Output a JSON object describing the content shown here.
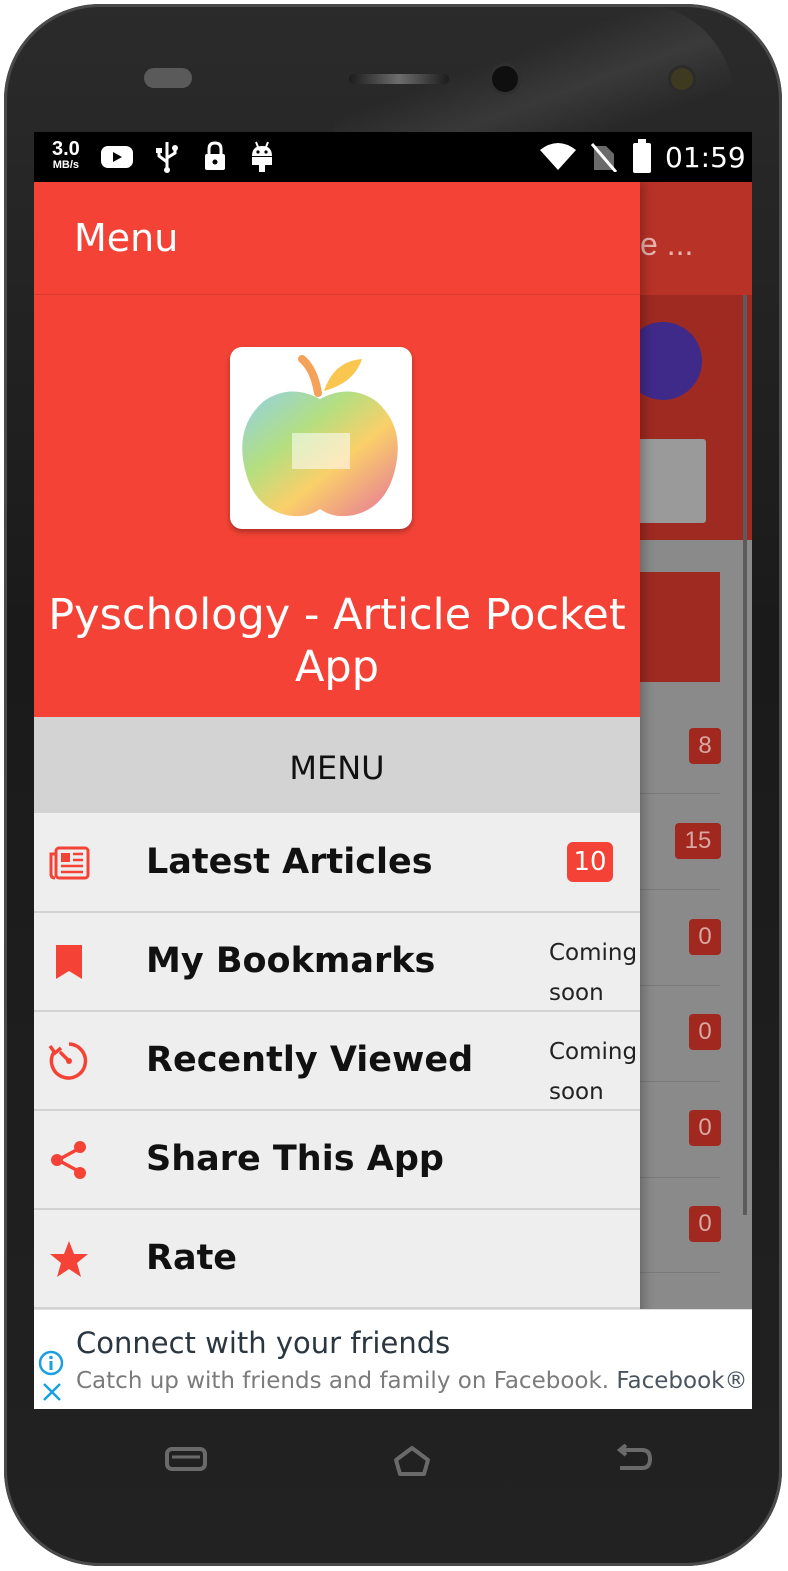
{
  "status_bar": {
    "speed_value": "3.0",
    "speed_unit": "MB/s",
    "time": "01:59",
    "icons": [
      "youtube-icon",
      "usb-icon",
      "lock-icon",
      "android-icon",
      "wifi-icon",
      "no-sim-icon",
      "battery-icon"
    ]
  },
  "background_app": {
    "title_fragment": "e ...",
    "badges": [
      "8",
      "15",
      "0",
      "0",
      "0",
      "0"
    ]
  },
  "drawer": {
    "toolbar_title": "Menu",
    "app_name": "Pyschology - Article Pocket App",
    "section_header": "MENU",
    "items": [
      {
        "icon": "newspaper-icon",
        "label": "Latest Articles",
        "badge": "10"
      },
      {
        "icon": "bookmark-icon",
        "label": "My Bookmarks",
        "note_line1": "Coming",
        "note_line2": "soon"
      },
      {
        "icon": "history-icon",
        "label": "Recently Viewed",
        "note_line1": "Coming",
        "note_line2": "soon"
      },
      {
        "icon": "share-icon",
        "label": "Share This App"
      },
      {
        "icon": "star-icon",
        "label": "Rate"
      }
    ]
  },
  "ad": {
    "headline": "Connect with your friends",
    "body": "Catch up with friends and family on Facebook.",
    "brand": "Facebook®"
  },
  "colors": {
    "accent": "#f44336",
    "section_bg": "#d3d3d3",
    "drawer_bg": "#eeeeee"
  }
}
